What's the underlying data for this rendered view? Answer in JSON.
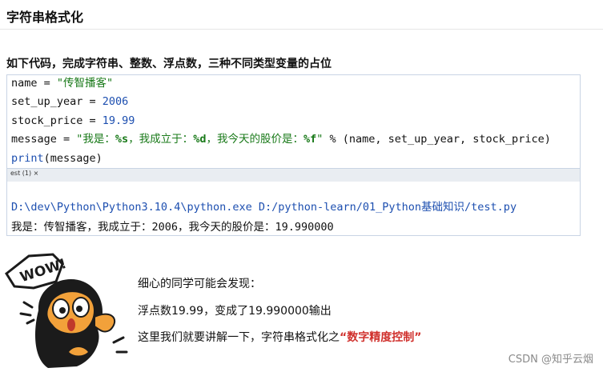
{
  "slide": {
    "title": "字符串格式化",
    "subtitle": "如下代码，完成字符串、整数、浮点数，三种不同类型变量的占位"
  },
  "code": {
    "l1_var": "name = ",
    "l1_str": "\"传智播客\"",
    "l2_var": "set_up_year = ",
    "l2_num": "2006",
    "l3_var": "stock_price = ",
    "l3_num": "19.99",
    "l4_var": "message = ",
    "l4_str_a": "\"我是：",
    "l4_fmt_a": "%s",
    "l4_str_b": "，我成立于：",
    "l4_fmt_b": "%d",
    "l4_str_c": "，我今天的股价是：",
    "l4_fmt_c": "%f",
    "l4_str_d": "\"",
    "l4_tail": " % (name, set_up_year, stock_price)",
    "l5_fn": "print",
    "l5_args": "(message)"
  },
  "console": {
    "tab_label": "est (1) ×",
    "command": "D:\\dev\\Python\\Python3.10.4\\python.exe D:/python-learn/01_Python基础知识/test.py",
    "output": "我是：传智播客，我成立于：2006，我今天的股价是：19.990000"
  },
  "mascot": {
    "wow_text": "WOW!"
  },
  "notes": {
    "line1": "细心的同学可能会发现：",
    "line2": "浮点数19.99，变成了19.990000输出",
    "line3_prefix": "这里我们就要讲解一下，字符串格式化之",
    "line3_highlight": "“数字精度控制”"
  },
  "watermark": "CSDN @知乎云烟",
  "colors": {
    "string_green": "#1a7a1a",
    "number_blue": "#1d4fb0",
    "highlight_red": "#d0312d",
    "mascot_orange": "#f2a13a",
    "mascot_black": "#1b1b1b"
  }
}
